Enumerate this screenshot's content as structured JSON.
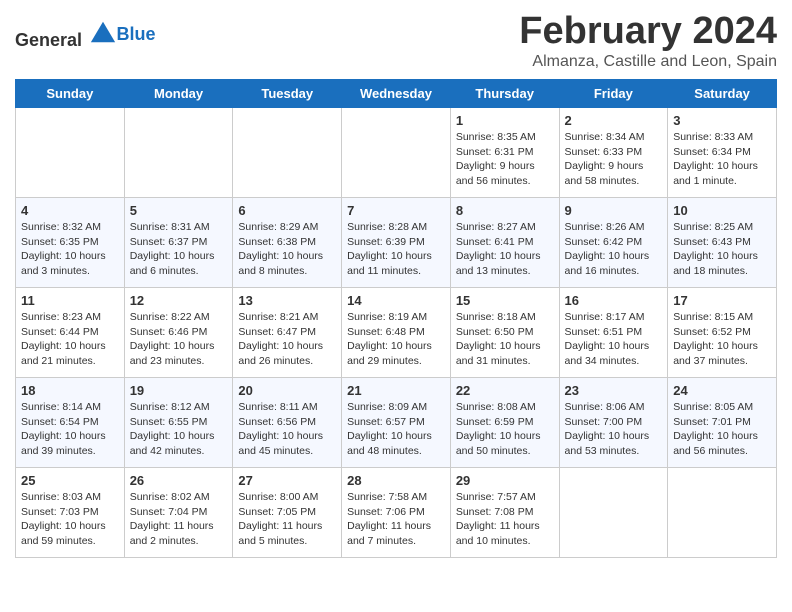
{
  "logo": {
    "general": "General",
    "blue": "Blue"
  },
  "title": "February 2024",
  "subtitle": "Almanza, Castille and Leon, Spain",
  "headers": [
    "Sunday",
    "Monday",
    "Tuesday",
    "Wednesday",
    "Thursday",
    "Friday",
    "Saturday"
  ],
  "weeks": [
    [
      {
        "day": "",
        "info": ""
      },
      {
        "day": "",
        "info": ""
      },
      {
        "day": "",
        "info": ""
      },
      {
        "day": "",
        "info": ""
      },
      {
        "day": "1",
        "info": "Sunrise: 8:35 AM\nSunset: 6:31 PM\nDaylight: 9 hours\nand 56 minutes."
      },
      {
        "day": "2",
        "info": "Sunrise: 8:34 AM\nSunset: 6:33 PM\nDaylight: 9 hours\nand 58 minutes."
      },
      {
        "day": "3",
        "info": "Sunrise: 8:33 AM\nSunset: 6:34 PM\nDaylight: 10 hours\nand 1 minute."
      }
    ],
    [
      {
        "day": "4",
        "info": "Sunrise: 8:32 AM\nSunset: 6:35 PM\nDaylight: 10 hours\nand 3 minutes."
      },
      {
        "day": "5",
        "info": "Sunrise: 8:31 AM\nSunset: 6:37 PM\nDaylight: 10 hours\nand 6 minutes."
      },
      {
        "day": "6",
        "info": "Sunrise: 8:29 AM\nSunset: 6:38 PM\nDaylight: 10 hours\nand 8 minutes."
      },
      {
        "day": "7",
        "info": "Sunrise: 8:28 AM\nSunset: 6:39 PM\nDaylight: 10 hours\nand 11 minutes."
      },
      {
        "day": "8",
        "info": "Sunrise: 8:27 AM\nSunset: 6:41 PM\nDaylight: 10 hours\nand 13 minutes."
      },
      {
        "day": "9",
        "info": "Sunrise: 8:26 AM\nSunset: 6:42 PM\nDaylight: 10 hours\nand 16 minutes."
      },
      {
        "day": "10",
        "info": "Sunrise: 8:25 AM\nSunset: 6:43 PM\nDaylight: 10 hours\nand 18 minutes."
      }
    ],
    [
      {
        "day": "11",
        "info": "Sunrise: 8:23 AM\nSunset: 6:44 PM\nDaylight: 10 hours\nand 21 minutes."
      },
      {
        "day": "12",
        "info": "Sunrise: 8:22 AM\nSunset: 6:46 PM\nDaylight: 10 hours\nand 23 minutes."
      },
      {
        "day": "13",
        "info": "Sunrise: 8:21 AM\nSunset: 6:47 PM\nDaylight: 10 hours\nand 26 minutes."
      },
      {
        "day": "14",
        "info": "Sunrise: 8:19 AM\nSunset: 6:48 PM\nDaylight: 10 hours\nand 29 minutes."
      },
      {
        "day": "15",
        "info": "Sunrise: 8:18 AM\nSunset: 6:50 PM\nDaylight: 10 hours\nand 31 minutes."
      },
      {
        "day": "16",
        "info": "Sunrise: 8:17 AM\nSunset: 6:51 PM\nDaylight: 10 hours\nand 34 minutes."
      },
      {
        "day": "17",
        "info": "Sunrise: 8:15 AM\nSunset: 6:52 PM\nDaylight: 10 hours\nand 37 minutes."
      }
    ],
    [
      {
        "day": "18",
        "info": "Sunrise: 8:14 AM\nSunset: 6:54 PM\nDaylight: 10 hours\nand 39 minutes."
      },
      {
        "day": "19",
        "info": "Sunrise: 8:12 AM\nSunset: 6:55 PM\nDaylight: 10 hours\nand 42 minutes."
      },
      {
        "day": "20",
        "info": "Sunrise: 8:11 AM\nSunset: 6:56 PM\nDaylight: 10 hours\nand 45 minutes."
      },
      {
        "day": "21",
        "info": "Sunrise: 8:09 AM\nSunset: 6:57 PM\nDaylight: 10 hours\nand 48 minutes."
      },
      {
        "day": "22",
        "info": "Sunrise: 8:08 AM\nSunset: 6:59 PM\nDaylight: 10 hours\nand 50 minutes."
      },
      {
        "day": "23",
        "info": "Sunrise: 8:06 AM\nSunset: 7:00 PM\nDaylight: 10 hours\nand 53 minutes."
      },
      {
        "day": "24",
        "info": "Sunrise: 8:05 AM\nSunset: 7:01 PM\nDaylight: 10 hours\nand 56 minutes."
      }
    ],
    [
      {
        "day": "25",
        "info": "Sunrise: 8:03 AM\nSunset: 7:03 PM\nDaylight: 10 hours\nand 59 minutes."
      },
      {
        "day": "26",
        "info": "Sunrise: 8:02 AM\nSunset: 7:04 PM\nDaylight: 11 hours\nand 2 minutes."
      },
      {
        "day": "27",
        "info": "Sunrise: 8:00 AM\nSunset: 7:05 PM\nDaylight: 11 hours\nand 5 minutes."
      },
      {
        "day": "28",
        "info": "Sunrise: 7:58 AM\nSunset: 7:06 PM\nDaylight: 11 hours\nand 7 minutes."
      },
      {
        "day": "29",
        "info": "Sunrise: 7:57 AM\nSunset: 7:08 PM\nDaylight: 11 hours\nand 10 minutes."
      },
      {
        "day": "",
        "info": ""
      },
      {
        "day": "",
        "info": ""
      }
    ]
  ]
}
